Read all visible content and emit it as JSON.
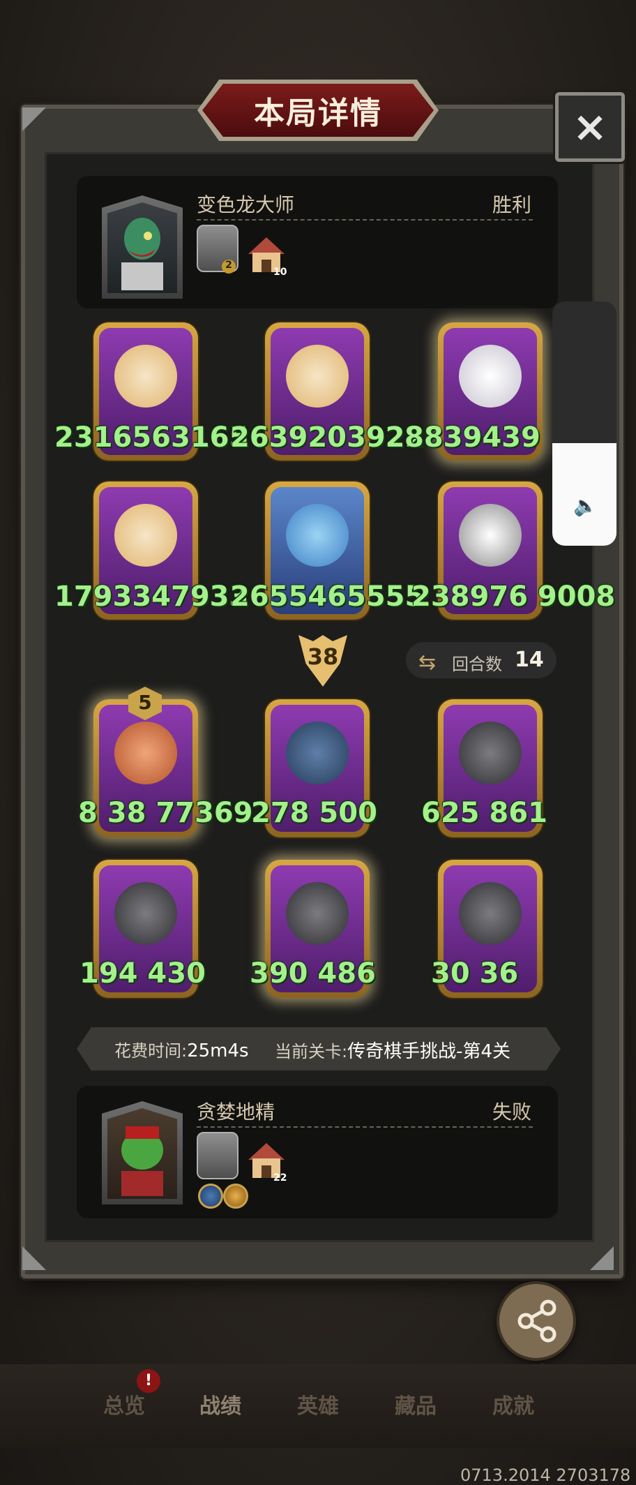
{
  "dialog": {
    "title": "本局详情",
    "close_icon": "×"
  },
  "top_player": {
    "name": "变色龙大师",
    "result": "胜利",
    "icons": [
      {
        "name": "cage-icon",
        "badge": "2"
      },
      {
        "name": "house-icon",
        "badge": "10"
      }
    ]
  },
  "top_board": {
    "rows": [
      [
        {
          "stat_text": "2316563165"
        },
        {
          "stat_text": "2639203922"
        },
        {
          "stat_text": "8839439"
        }
      ],
      [
        {
          "stat_text": "1793347933"
        },
        {
          "stat_text": "2655465555"
        },
        {
          "stat_text": "238976 9008"
        }
      ]
    ]
  },
  "turn": {
    "value": "38"
  },
  "rounds": {
    "label": "回合数",
    "value": "14"
  },
  "bottom_board": {
    "level_badge": "5",
    "rows": [
      [
        {
          "stat_text": "8 38 77369"
        },
        {
          "stat_text": "278 500"
        },
        {
          "stat_text": "625 861"
        }
      ],
      [
        {
          "stat_text": "194 430"
        },
        {
          "stat_text": "390 486"
        },
        {
          "stat_text": "30 36"
        }
      ]
    ]
  },
  "info_bar": {
    "time_label": "花费时间:",
    "time_value": "25m4s",
    "stage_label": "当前关卡:",
    "stage_value": "传奇棋手挑战-第4关"
  },
  "bottom_player": {
    "name": "贪婪地精",
    "result": "失败",
    "icons": [
      {
        "name": "dungeon-icon"
      },
      {
        "name": "house-icon",
        "badge": "22"
      },
      {
        "name": "sword-skill-icon"
      },
      {
        "name": "gold-skill-icon"
      }
    ]
  },
  "share": {
    "label": "分享"
  },
  "nav": {
    "alert": "!",
    "items": [
      "总览",
      "战绩",
      "英雄",
      "藏品",
      "成就"
    ]
  },
  "footer": {
    "id": "0713.2014 2703178"
  },
  "colors": {
    "stat_green": "#a4f08c",
    "title_red": "#7b1b1b",
    "gold": "#d7a743"
  }
}
